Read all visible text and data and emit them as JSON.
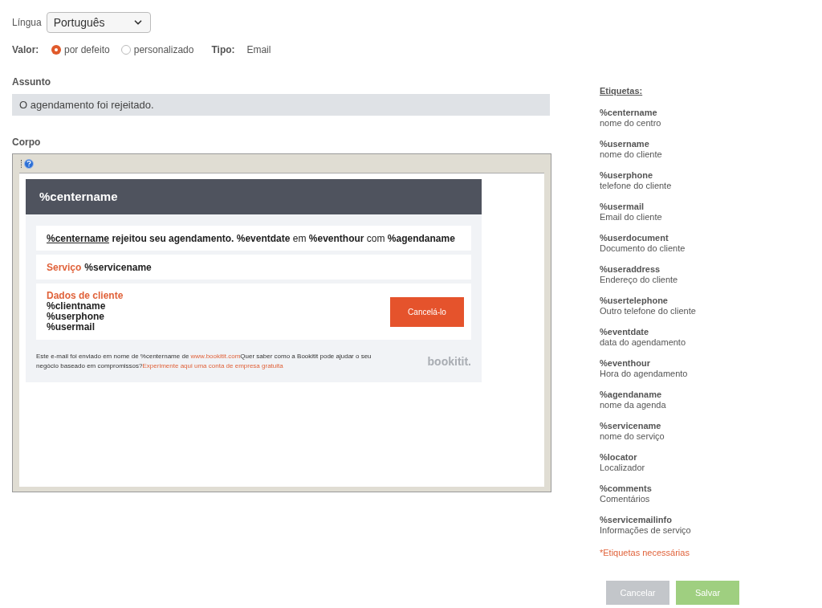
{
  "language": {
    "label": "Língua",
    "value": "Português"
  },
  "value_row": {
    "label": "Valor:",
    "options": [
      {
        "label": "por defeito",
        "selected": true
      },
      {
        "label": "personalizado",
        "selected": false
      }
    ],
    "type_label": "Tipo:",
    "type_value": "Email"
  },
  "subject": {
    "label": "Assunto",
    "value": "O agendamento foi rejeitado."
  },
  "body": {
    "label": "Corpo",
    "email": {
      "header": "%centername",
      "message": [
        {
          "text": "%centername",
          "bold": true,
          "underline": true
        },
        {
          "text": " rejeitou seu agendamento. %eventdate",
          "bold": true,
          "underline": false
        },
        {
          "text": " em ",
          "bold": false,
          "underline": false
        },
        {
          "text": "%eventhour",
          "bold": true,
          "underline": false
        },
        {
          "text": " com ",
          "bold": false,
          "underline": false
        },
        {
          "text": "%agendaname",
          "bold": true,
          "underline": false
        }
      ],
      "service_label": "Serviço",
      "service_value": "%servicename",
      "client_title": "Dados de cliente",
      "client_lines": [
        "%clientname",
        "%userphone",
        "%usermail"
      ],
      "cancel_button": "Cancelá-lo",
      "footer": [
        {
          "text": "Este e-mail foi enviado em nome de %centername de ",
          "link": false
        },
        {
          "text": "www.bookitit.com",
          "link": true
        },
        {
          "text": "Quer saber como a Bookitit pode ajudar o seu negócio baseado em compromissos?",
          "link": false
        },
        {
          "text": "Experimente aqui uma conta de empresa gratuita",
          "link": true
        }
      ],
      "logo": "bookitit."
    }
  },
  "tags": {
    "title": "Etiquetas:",
    "items": [
      {
        "tag": "%centername",
        "desc": "nome do centro"
      },
      {
        "tag": "%username",
        "desc": "nome do cliente"
      },
      {
        "tag": "%userphone",
        "desc": "telefone do cliente"
      },
      {
        "tag": "%usermail",
        "desc": "Email do cliente"
      },
      {
        "tag": "%userdocument",
        "desc": "Documento do cliente"
      },
      {
        "tag": "%useraddress",
        "desc": "Endereço do cliente"
      },
      {
        "tag": "%usertelephone",
        "desc": "Outro telefone do cliente"
      },
      {
        "tag": "%eventdate",
        "desc": "data do agendamento"
      },
      {
        "tag": "%eventhour",
        "desc": "Hora do agendamento"
      },
      {
        "tag": "%agendaname",
        "desc": "nome da agenda"
      },
      {
        "tag": "%servicename",
        "desc": "nome do serviço"
      },
      {
        "tag": "%locator",
        "desc": "Localizador"
      },
      {
        "tag": "%comments",
        "desc": "Comentários"
      },
      {
        "tag": "%servicemailinfo",
        "desc": "Informações de serviço"
      }
    ],
    "note": "*Etiquetas necessárias"
  },
  "buttons": {
    "cancel": "Cancelar",
    "save": "Salvar"
  }
}
